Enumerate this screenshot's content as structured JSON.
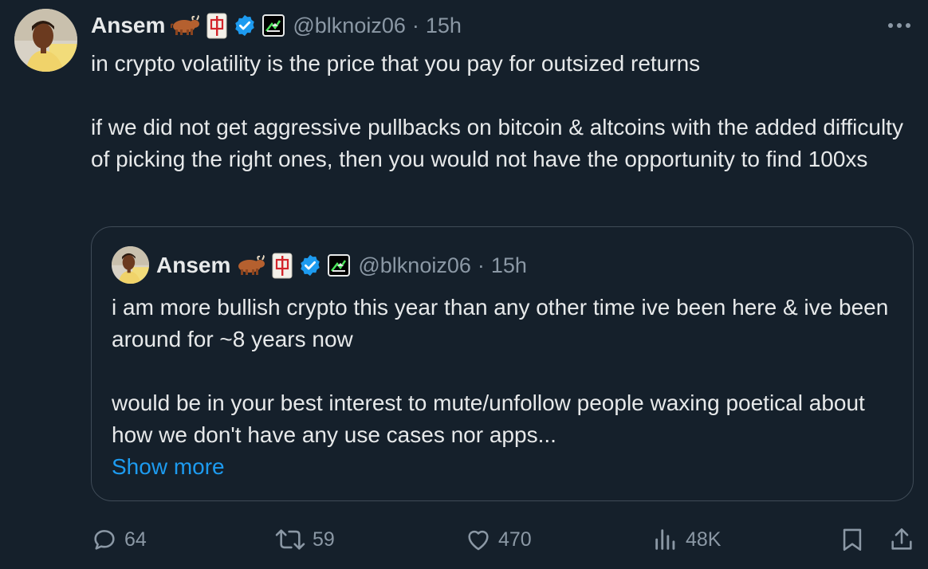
{
  "tweet": {
    "author_name": "Ansem",
    "emojis": [
      "ox-emoji",
      "mahjong-red-dragon-emoji"
    ],
    "handle": "@blknoiz06",
    "separator": "·",
    "time": "15h",
    "text_line1": "in crypto volatility is the price that you pay for outsized returns",
    "text_line2": "if we did not get aggressive pullbacks on bitcoin & altcoins with the added difficulty of picking the right ones, then you would not have the opportunity to find 100xs"
  },
  "quoted": {
    "author_name": "Ansem",
    "handle": "@blknoiz06",
    "separator": "·",
    "time": "15h",
    "text_line1": "i am more bullish crypto this year than any other time ive been here & ive been around for ~8 years now",
    "text_line2": "would be in your best interest to mute/unfollow people waxing poetical about how we don't have any use cases nor apps...",
    "show_more": "Show more"
  },
  "actions": {
    "replies": "64",
    "reposts": "59",
    "likes": "470",
    "views": "48K"
  },
  "colors": {
    "background": "#15202b",
    "text": "#e7e9ea",
    "muted": "#8b98a5",
    "accent": "#1d9bf0",
    "verified": "#1d9bf0"
  }
}
